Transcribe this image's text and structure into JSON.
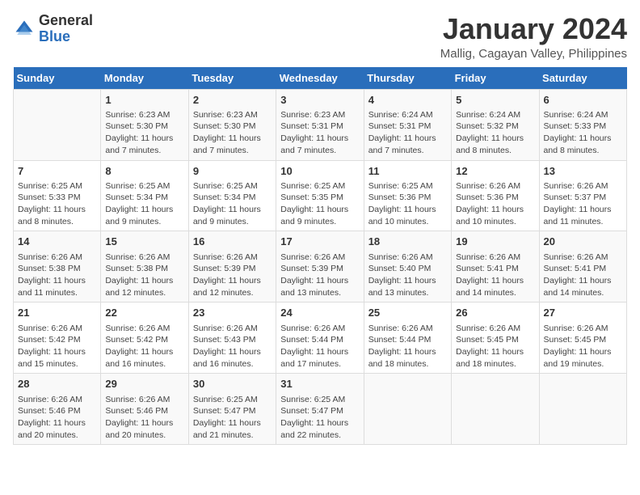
{
  "logo": {
    "general": "General",
    "blue": "Blue"
  },
  "header": {
    "title": "January 2024",
    "subtitle": "Mallig, Cagayan Valley, Philippines"
  },
  "weekdays": [
    "Sunday",
    "Monday",
    "Tuesday",
    "Wednesday",
    "Thursday",
    "Friday",
    "Saturday"
  ],
  "weeks": [
    [
      {
        "day": "",
        "info": ""
      },
      {
        "day": "1",
        "info": "Sunrise: 6:23 AM\nSunset: 5:30 PM\nDaylight: 11 hours and 7 minutes."
      },
      {
        "day": "2",
        "info": "Sunrise: 6:23 AM\nSunset: 5:30 PM\nDaylight: 11 hours and 7 minutes."
      },
      {
        "day": "3",
        "info": "Sunrise: 6:23 AM\nSunset: 5:31 PM\nDaylight: 11 hours and 7 minutes."
      },
      {
        "day": "4",
        "info": "Sunrise: 6:24 AM\nSunset: 5:31 PM\nDaylight: 11 hours and 7 minutes."
      },
      {
        "day": "5",
        "info": "Sunrise: 6:24 AM\nSunset: 5:32 PM\nDaylight: 11 hours and 8 minutes."
      },
      {
        "day": "6",
        "info": "Sunrise: 6:24 AM\nSunset: 5:33 PM\nDaylight: 11 hours and 8 minutes."
      }
    ],
    [
      {
        "day": "7",
        "info": "Sunrise: 6:25 AM\nSunset: 5:33 PM\nDaylight: 11 hours and 8 minutes."
      },
      {
        "day": "8",
        "info": "Sunrise: 6:25 AM\nSunset: 5:34 PM\nDaylight: 11 hours and 9 minutes."
      },
      {
        "day": "9",
        "info": "Sunrise: 6:25 AM\nSunset: 5:34 PM\nDaylight: 11 hours and 9 minutes."
      },
      {
        "day": "10",
        "info": "Sunrise: 6:25 AM\nSunset: 5:35 PM\nDaylight: 11 hours and 9 minutes."
      },
      {
        "day": "11",
        "info": "Sunrise: 6:25 AM\nSunset: 5:36 PM\nDaylight: 11 hours and 10 minutes."
      },
      {
        "day": "12",
        "info": "Sunrise: 6:26 AM\nSunset: 5:36 PM\nDaylight: 11 hours and 10 minutes."
      },
      {
        "day": "13",
        "info": "Sunrise: 6:26 AM\nSunset: 5:37 PM\nDaylight: 11 hours and 11 minutes."
      }
    ],
    [
      {
        "day": "14",
        "info": "Sunrise: 6:26 AM\nSunset: 5:38 PM\nDaylight: 11 hours and 11 minutes."
      },
      {
        "day": "15",
        "info": "Sunrise: 6:26 AM\nSunset: 5:38 PM\nDaylight: 11 hours and 12 minutes."
      },
      {
        "day": "16",
        "info": "Sunrise: 6:26 AM\nSunset: 5:39 PM\nDaylight: 11 hours and 12 minutes."
      },
      {
        "day": "17",
        "info": "Sunrise: 6:26 AM\nSunset: 5:39 PM\nDaylight: 11 hours and 13 minutes."
      },
      {
        "day": "18",
        "info": "Sunrise: 6:26 AM\nSunset: 5:40 PM\nDaylight: 11 hours and 13 minutes."
      },
      {
        "day": "19",
        "info": "Sunrise: 6:26 AM\nSunset: 5:41 PM\nDaylight: 11 hours and 14 minutes."
      },
      {
        "day": "20",
        "info": "Sunrise: 6:26 AM\nSunset: 5:41 PM\nDaylight: 11 hours and 14 minutes."
      }
    ],
    [
      {
        "day": "21",
        "info": "Sunrise: 6:26 AM\nSunset: 5:42 PM\nDaylight: 11 hours and 15 minutes."
      },
      {
        "day": "22",
        "info": "Sunrise: 6:26 AM\nSunset: 5:42 PM\nDaylight: 11 hours and 16 minutes."
      },
      {
        "day": "23",
        "info": "Sunrise: 6:26 AM\nSunset: 5:43 PM\nDaylight: 11 hours and 16 minutes."
      },
      {
        "day": "24",
        "info": "Sunrise: 6:26 AM\nSunset: 5:44 PM\nDaylight: 11 hours and 17 minutes."
      },
      {
        "day": "25",
        "info": "Sunrise: 6:26 AM\nSunset: 5:44 PM\nDaylight: 11 hours and 18 minutes."
      },
      {
        "day": "26",
        "info": "Sunrise: 6:26 AM\nSunset: 5:45 PM\nDaylight: 11 hours and 18 minutes."
      },
      {
        "day": "27",
        "info": "Sunrise: 6:26 AM\nSunset: 5:45 PM\nDaylight: 11 hours and 19 minutes."
      }
    ],
    [
      {
        "day": "28",
        "info": "Sunrise: 6:26 AM\nSunset: 5:46 PM\nDaylight: 11 hours and 20 minutes."
      },
      {
        "day": "29",
        "info": "Sunrise: 6:26 AM\nSunset: 5:46 PM\nDaylight: 11 hours and 20 minutes."
      },
      {
        "day": "30",
        "info": "Sunrise: 6:25 AM\nSunset: 5:47 PM\nDaylight: 11 hours and 21 minutes."
      },
      {
        "day": "31",
        "info": "Sunrise: 6:25 AM\nSunset: 5:47 PM\nDaylight: 11 hours and 22 minutes."
      },
      {
        "day": "",
        "info": ""
      },
      {
        "day": "",
        "info": ""
      },
      {
        "day": "",
        "info": ""
      }
    ]
  ]
}
